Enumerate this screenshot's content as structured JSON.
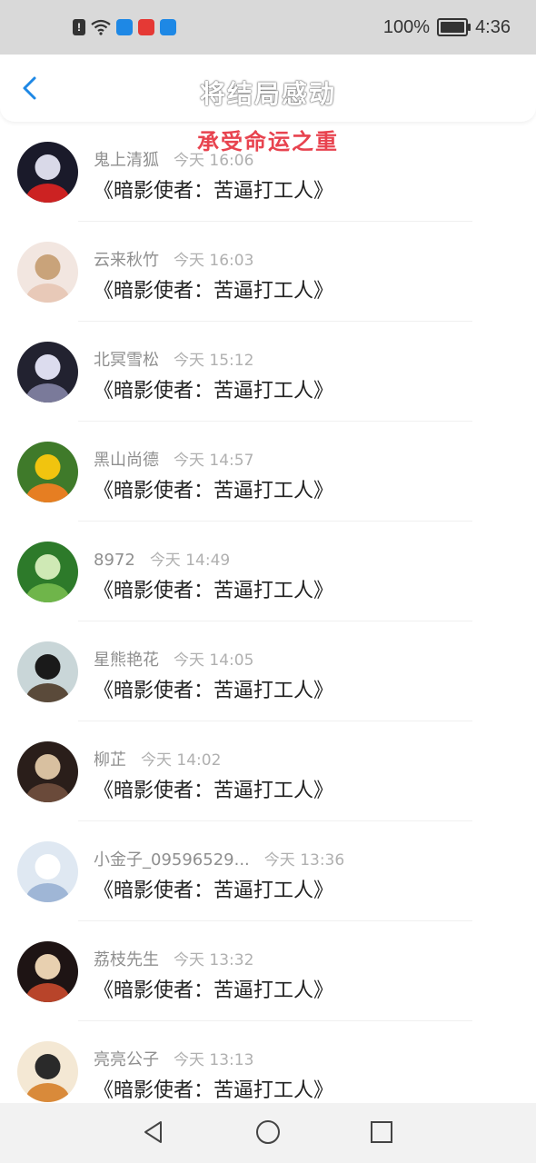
{
  "status_bar": {
    "battery_percent_text": "100%",
    "battery_level": 1.0,
    "time": "4:36",
    "icons": [
      "alert-icon",
      "wifi-icon",
      "app-icon-blue",
      "app-icon-red",
      "app-icon-weather"
    ]
  },
  "header": {
    "back_icon": "chevron-left-icon",
    "title": "将结局感动",
    "subtitle": "承受命运之重"
  },
  "colors": {
    "accent": "#1e88e5",
    "subtitle_red": "#e8434f",
    "name_gray": "#8f8f8f",
    "time_gray": "#b0b0b0"
  },
  "items": [
    {
      "name": "鬼上清狐",
      "time": "今天 16:06",
      "message": "《暗影使者：苦逼打工人》"
    },
    {
      "name": "云来秋竹",
      "time": "今天 16:03",
      "message": "《暗影使者：苦逼打工人》"
    },
    {
      "name": "北冥雪松",
      "time": "今天 15:12",
      "message": "《暗影使者：苦逼打工人》"
    },
    {
      "name": "黑山尚德",
      "time": "今天 14:57",
      "message": "《暗影使者：苦逼打工人》"
    },
    {
      "name": "8972",
      "time": "今天 14:49",
      "message": "《暗影使者：苦逼打工人》"
    },
    {
      "name": "星熊艳花",
      "time": "今天 14:05",
      "message": "《暗影使者：苦逼打工人》"
    },
    {
      "name": "柳芷",
      "time": "今天 14:02",
      "message": "《暗影使者：苦逼打工人》"
    },
    {
      "name": "小金子_09596529...",
      "time": "今天 13:36",
      "message": "《暗影使者：苦逼打工人》"
    },
    {
      "name": "荔枝先生",
      "time": "今天 13:32",
      "message": "《暗影使者：苦逼打工人》"
    },
    {
      "name": "亮亮公子",
      "time": "今天 13:13",
      "message": "《暗影使者：苦逼打工人》"
    }
  ],
  "nav_bar": {
    "back_icon": "triangle-back-icon",
    "home_icon": "circle-home-icon",
    "recents_icon": "square-recents-icon"
  }
}
